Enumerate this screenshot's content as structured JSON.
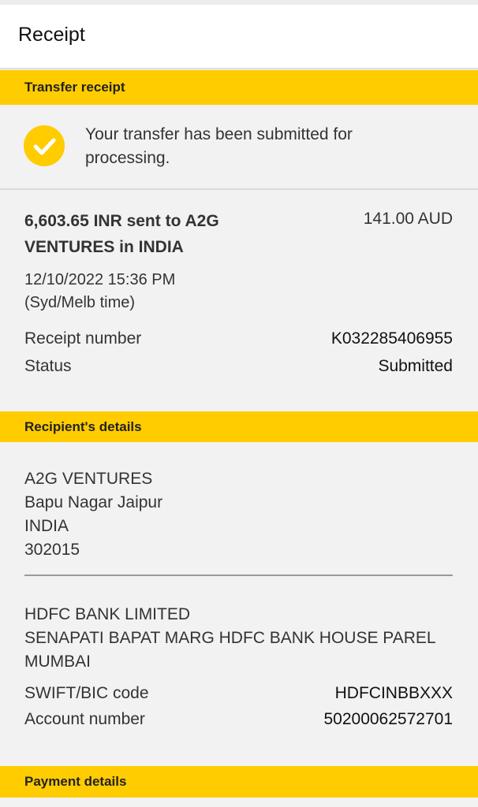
{
  "header": {
    "title": "Receipt"
  },
  "transfer_section": {
    "heading": "Transfer receipt",
    "notice_line1": "Your transfer has been submitted for",
    "notice_line2": "processing.",
    "amount_line1": "6,603.65 INR sent to A2G",
    "amount_line2": "VENTURES in INDIA",
    "aud_amount": "141.00 AUD",
    "date": "12/10/2022 15:36 PM",
    "timezone": "(Syd/Melb time)",
    "receipt_label": "Receipt number",
    "receipt_value": "K032285406955",
    "status_label": "Status",
    "status_value": "Submitted"
  },
  "recipient_section": {
    "heading": "Recipient's details",
    "name": "A2G VENTURES",
    "address_line": "Bapu Nagar Jaipur",
    "country": "INDIA",
    "postcode": "302015",
    "bank_name": "HDFC BANK LIMITED",
    "bank_address_line1": "SENAPATI BAPAT MARG HDFC BANK HOUSE PAREL",
    "bank_address_line2": "MUMBAI",
    "swift_label": "SWIFT/BIC code",
    "swift_value": "HDFCINBBXXX",
    "account_label": "Account number",
    "account_value": "50200062572701"
  },
  "payment_section": {
    "heading": "Payment details"
  },
  "icons": {
    "success": "checkmark-circle-icon"
  },
  "colors": {
    "accent": "#ffcc00",
    "background": "#f2f2f2"
  }
}
